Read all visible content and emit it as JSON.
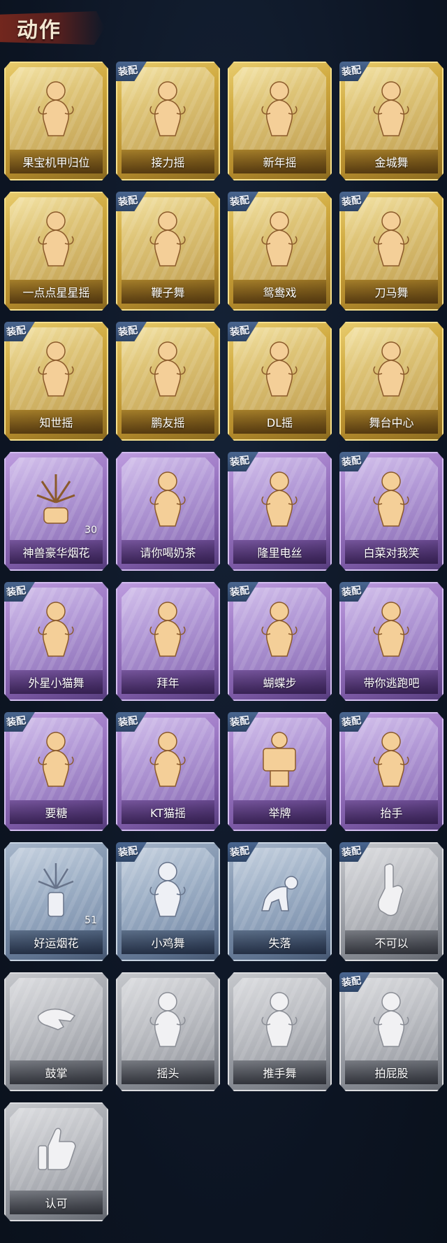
{
  "header": {
    "title": "动作"
  },
  "badge_text": "装配",
  "colors": {
    "gold": "#cfa93f",
    "purple": "#9a76c2",
    "blue": "#7f93ad",
    "gray": "#a3a6ad",
    "badge": "#3a5680"
  },
  "items": [
    {
      "name": "果宝机甲归位",
      "rarity": "gold",
      "equipped": false,
      "icon": "figure-icon"
    },
    {
      "name": "接力摇",
      "rarity": "gold",
      "equipped": true,
      "icon": "figure-icon"
    },
    {
      "name": "新年摇",
      "rarity": "gold",
      "equipped": false,
      "icon": "figure-icon"
    },
    {
      "name": "金城舞",
      "rarity": "gold",
      "equipped": true,
      "icon": "figure-icon"
    },
    {
      "name": "一点点星星摇",
      "rarity": "gold",
      "equipped": false,
      "icon": "figure-icon"
    },
    {
      "name": "鞭子舞",
      "rarity": "gold",
      "equipped": true,
      "icon": "figure-icon"
    },
    {
      "name": "鸳鸯戏",
      "rarity": "gold",
      "equipped": true,
      "icon": "figure-icon"
    },
    {
      "name": "刀马舞",
      "rarity": "gold",
      "equipped": true,
      "icon": "figure-icon"
    },
    {
      "name": "知世摇",
      "rarity": "gold",
      "equipped": true,
      "icon": "figure-icon"
    },
    {
      "name": "鹏友摇",
      "rarity": "gold",
      "equipped": true,
      "icon": "figure-icon"
    },
    {
      "name": "DL摇",
      "rarity": "gold",
      "equipped": true,
      "icon": "figure-icon"
    },
    {
      "name": "舞台中心",
      "rarity": "gold",
      "equipped": false,
      "icon": "figure-icon"
    },
    {
      "name": "神兽豪华烟花",
      "rarity": "purple",
      "equipped": false,
      "icon": "fireworks-icon",
      "count": "30"
    },
    {
      "name": "请你喝奶茶",
      "rarity": "purple",
      "equipped": false,
      "icon": "figure-icon"
    },
    {
      "name": "隆里电丝",
      "rarity": "purple",
      "equipped": true,
      "icon": "figure-icon"
    },
    {
      "name": "白菜对我笑",
      "rarity": "purple",
      "equipped": true,
      "icon": "figure-icon"
    },
    {
      "name": "外星小猫舞",
      "rarity": "purple",
      "equipped": true,
      "icon": "figure-icon"
    },
    {
      "name": "拜年",
      "rarity": "purple",
      "equipped": false,
      "icon": "figure-icon"
    },
    {
      "name": "蝴蝶步",
      "rarity": "purple",
      "equipped": true,
      "icon": "figure-icon"
    },
    {
      "name": "带你逃跑吧",
      "rarity": "purple",
      "equipped": true,
      "icon": "figure-icon"
    },
    {
      "name": "要糖",
      "rarity": "purple",
      "equipped": true,
      "icon": "figure-icon"
    },
    {
      "name": "KT猫摇",
      "rarity": "purple",
      "equipped": true,
      "icon": "figure-icon"
    },
    {
      "name": "举牌",
      "rarity": "purple",
      "equipped": true,
      "icon": "sign-icon"
    },
    {
      "name": "抬手",
      "rarity": "purple",
      "equipped": true,
      "icon": "figure-icon"
    },
    {
      "name": "好运烟花",
      "rarity": "blue",
      "equipped": false,
      "icon": "firework-can-icon",
      "count": "51"
    },
    {
      "name": "小鸡舞",
      "rarity": "blue",
      "equipped": true,
      "icon": "figure-icon"
    },
    {
      "name": "失落",
      "rarity": "blue",
      "equipped": true,
      "icon": "crawling-figure-icon"
    },
    {
      "name": "不可以",
      "rarity": "gray",
      "equipped": true,
      "icon": "hand-icon"
    },
    {
      "name": "鼓掌",
      "rarity": "gray",
      "equipped": false,
      "icon": "clapping-hands-icon"
    },
    {
      "name": "摇头",
      "rarity": "gray",
      "equipped": false,
      "icon": "figure-icon"
    },
    {
      "name": "推手舞",
      "rarity": "gray",
      "equipped": false,
      "icon": "figure-icon"
    },
    {
      "name": "拍屁股",
      "rarity": "gray",
      "equipped": true,
      "icon": "figure-icon"
    },
    {
      "name": "认可",
      "rarity": "gray",
      "equipped": false,
      "icon": "thumbs-up-icon"
    }
  ]
}
